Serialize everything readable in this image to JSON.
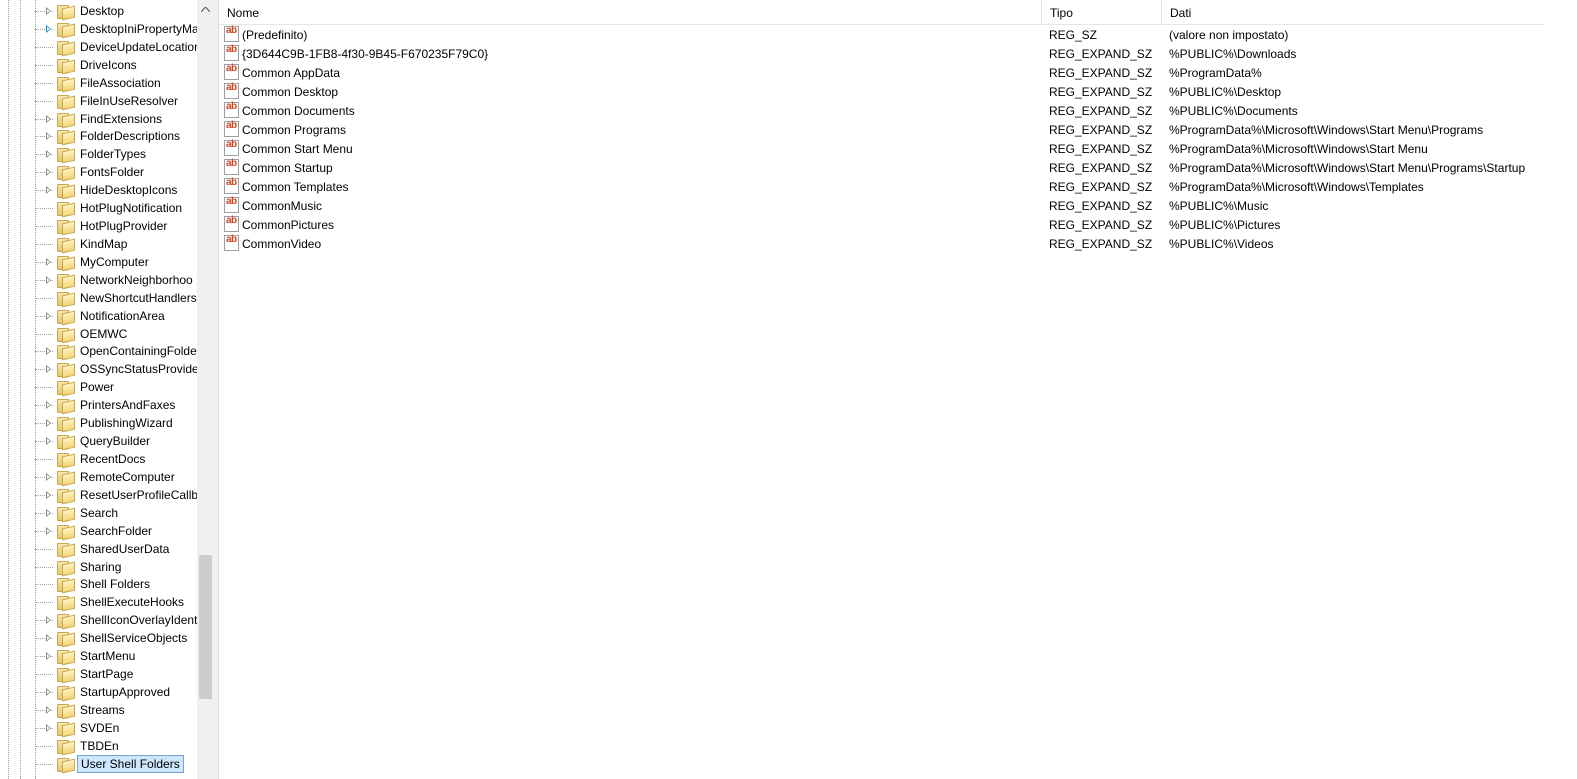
{
  "tree": {
    "items": [
      {
        "label": "Desktop",
        "expandable": true,
        "active": false
      },
      {
        "label": "DesktopIniPropertyMa",
        "expandable": true,
        "active": true
      },
      {
        "label": "DeviceUpdateLocation",
        "expandable": false,
        "active": false
      },
      {
        "label": "DriveIcons",
        "expandable": false,
        "active": false
      },
      {
        "label": "FileAssociation",
        "expandable": false,
        "active": false
      },
      {
        "label": "FileInUseResolver",
        "expandable": false,
        "active": false
      },
      {
        "label": "FindExtensions",
        "expandable": true,
        "active": false
      },
      {
        "label": "FolderDescriptions",
        "expandable": true,
        "active": false
      },
      {
        "label": "FolderTypes",
        "expandable": true,
        "active": false
      },
      {
        "label": "FontsFolder",
        "expandable": true,
        "active": false
      },
      {
        "label": "HideDesktopIcons",
        "expandable": true,
        "active": false
      },
      {
        "label": "HotPlugNotification",
        "expandable": false,
        "active": false
      },
      {
        "label": "HotPlugProvider",
        "expandable": false,
        "active": false
      },
      {
        "label": "KindMap",
        "expandable": false,
        "active": false
      },
      {
        "label": "MyComputer",
        "expandable": true,
        "active": false
      },
      {
        "label": "NetworkNeighborhoo",
        "expandable": true,
        "active": false
      },
      {
        "label": "NewShortcutHandlers",
        "expandable": false,
        "active": false
      },
      {
        "label": "NotificationArea",
        "expandable": true,
        "active": false
      },
      {
        "label": "OEMWC",
        "expandable": false,
        "active": false
      },
      {
        "label": "OpenContainingFolde",
        "expandable": true,
        "active": false
      },
      {
        "label": "OSSyncStatusProvider",
        "expandable": true,
        "active": false
      },
      {
        "label": "Power",
        "expandable": false,
        "active": false
      },
      {
        "label": "PrintersAndFaxes",
        "expandable": true,
        "active": false
      },
      {
        "label": "PublishingWizard",
        "expandable": true,
        "active": false
      },
      {
        "label": "QueryBuilder",
        "expandable": true,
        "active": false
      },
      {
        "label": "RecentDocs",
        "expandable": false,
        "active": false
      },
      {
        "label": "RemoteComputer",
        "expandable": true,
        "active": false
      },
      {
        "label": "ResetUserProfileCallba",
        "expandable": true,
        "active": false
      },
      {
        "label": "Search",
        "expandable": true,
        "active": false
      },
      {
        "label": "SearchFolder",
        "expandable": true,
        "active": false
      },
      {
        "label": "SharedUserData",
        "expandable": false,
        "active": false
      },
      {
        "label": "Sharing",
        "expandable": false,
        "active": false
      },
      {
        "label": "Shell Folders",
        "expandable": false,
        "active": false
      },
      {
        "label": "ShellExecuteHooks",
        "expandable": false,
        "active": false
      },
      {
        "label": "ShellIconOverlayIdent",
        "expandable": true,
        "active": false
      },
      {
        "label": "ShellServiceObjects",
        "expandable": true,
        "active": false
      },
      {
        "label": "StartMenu",
        "expandable": true,
        "active": false
      },
      {
        "label": "StartPage",
        "expandable": false,
        "active": false
      },
      {
        "label": "StartupApproved",
        "expandable": true,
        "active": false
      },
      {
        "label": "Streams",
        "expandable": true,
        "active": false
      },
      {
        "label": "SVDEn",
        "expandable": true,
        "active": false
      },
      {
        "label": "TBDEn",
        "expandable": false,
        "active": false
      },
      {
        "label": "User Shell Folders",
        "expandable": false,
        "active": false,
        "selected": true
      }
    ]
  },
  "list": {
    "columns": {
      "name": "Nome",
      "type": "Tipo",
      "data": "Dati"
    },
    "rows": [
      {
        "name": "(Predefinito)",
        "type": "REG_SZ",
        "data": "(valore non impostato)"
      },
      {
        "name": "{3D644C9B-1FB8-4f30-9B45-F670235F79C0}",
        "type": "REG_EXPAND_SZ",
        "data": "%PUBLIC%\\Downloads"
      },
      {
        "name": "Common AppData",
        "type": "REG_EXPAND_SZ",
        "data": "%ProgramData%"
      },
      {
        "name": "Common Desktop",
        "type": "REG_EXPAND_SZ",
        "data": "%PUBLIC%\\Desktop"
      },
      {
        "name": "Common Documents",
        "type": "REG_EXPAND_SZ",
        "data": "%PUBLIC%\\Documents"
      },
      {
        "name": "Common Programs",
        "type": "REG_EXPAND_SZ",
        "data": "%ProgramData%\\Microsoft\\Windows\\Start Menu\\Programs"
      },
      {
        "name": "Common Start Menu",
        "type": "REG_EXPAND_SZ",
        "data": "%ProgramData%\\Microsoft\\Windows\\Start Menu"
      },
      {
        "name": "Common Startup",
        "type": "REG_EXPAND_SZ",
        "data": "%ProgramData%\\Microsoft\\Windows\\Start Menu\\Programs\\Startup"
      },
      {
        "name": "Common Templates",
        "type": "REG_EXPAND_SZ",
        "data": "%ProgramData%\\Microsoft\\Windows\\Templates"
      },
      {
        "name": "CommonMusic",
        "type": "REG_EXPAND_SZ",
        "data": "%PUBLIC%\\Music"
      },
      {
        "name": "CommonPictures",
        "type": "REG_EXPAND_SZ",
        "data": "%PUBLIC%\\Pictures"
      },
      {
        "name": "CommonVideo",
        "type": "REG_EXPAND_SZ",
        "data": "%PUBLIC%\\Videos"
      }
    ]
  },
  "icons": {
    "folder": "folder-icon",
    "string_value": "reg-string-value-icon",
    "expander": "tree-expand-arrow-icon",
    "scroll_up": "scroll-up-arrow-icon"
  },
  "colors": {
    "selection_background": "#cce8ff",
    "selection_border": "#7da2ce",
    "value_icon_text": "#d0431c"
  }
}
